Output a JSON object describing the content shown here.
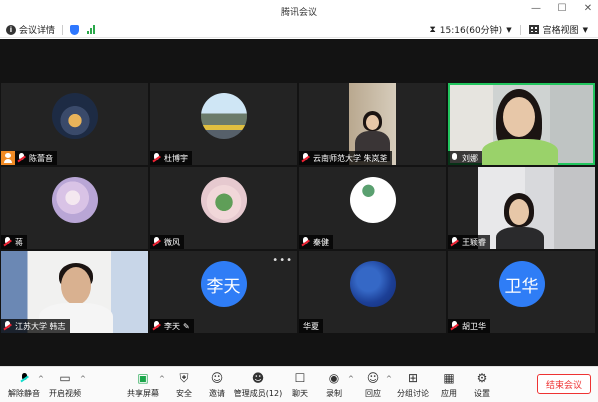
{
  "window": {
    "title": "腾讯会议",
    "minimize": "—",
    "maximize": "☐",
    "close": "✕"
  },
  "infobar": {
    "meeting_details": "会议详情",
    "time": "15:16(60分钟)",
    "view_mode": "宫格视图"
  },
  "participants": [
    {
      "name": "陈蕾音",
      "type": "image",
      "host": true
    },
    {
      "name": "杜博宇",
      "type": "image"
    },
    {
      "name": "云南师范大学 朱岚荃",
      "type": "video"
    },
    {
      "name": "刘娜",
      "type": "video",
      "active": true
    },
    {
      "name": "蒋",
      "type": "image"
    },
    {
      "name": "微风",
      "type": "image"
    },
    {
      "name": "秦健",
      "type": "image"
    },
    {
      "name": "王颖睿",
      "type": "video"
    },
    {
      "name": "江苏大学 韩志",
      "type": "video"
    },
    {
      "name": "李天",
      "type": "text",
      "avatar_text": "李天"
    },
    {
      "name": "华夏",
      "type": "image"
    },
    {
      "name": "胡卫华",
      "type": "text",
      "avatar_text": "卫华"
    }
  ],
  "toolbar": {
    "unmute": "解除静音",
    "start_video": "开启视频",
    "share_screen": "共享屏幕",
    "security": "安全",
    "invite": "邀请",
    "manage_members": "管理成员(12)",
    "chat": "聊天",
    "record": "录制",
    "reactions": "回应",
    "breakout": "分组讨论",
    "apps": "应用",
    "settings": "设置",
    "end_meeting": "结束会议"
  },
  "colors": {
    "accent": "#2f7df6",
    "active_border": "#22c55e",
    "end": "#e33333"
  }
}
